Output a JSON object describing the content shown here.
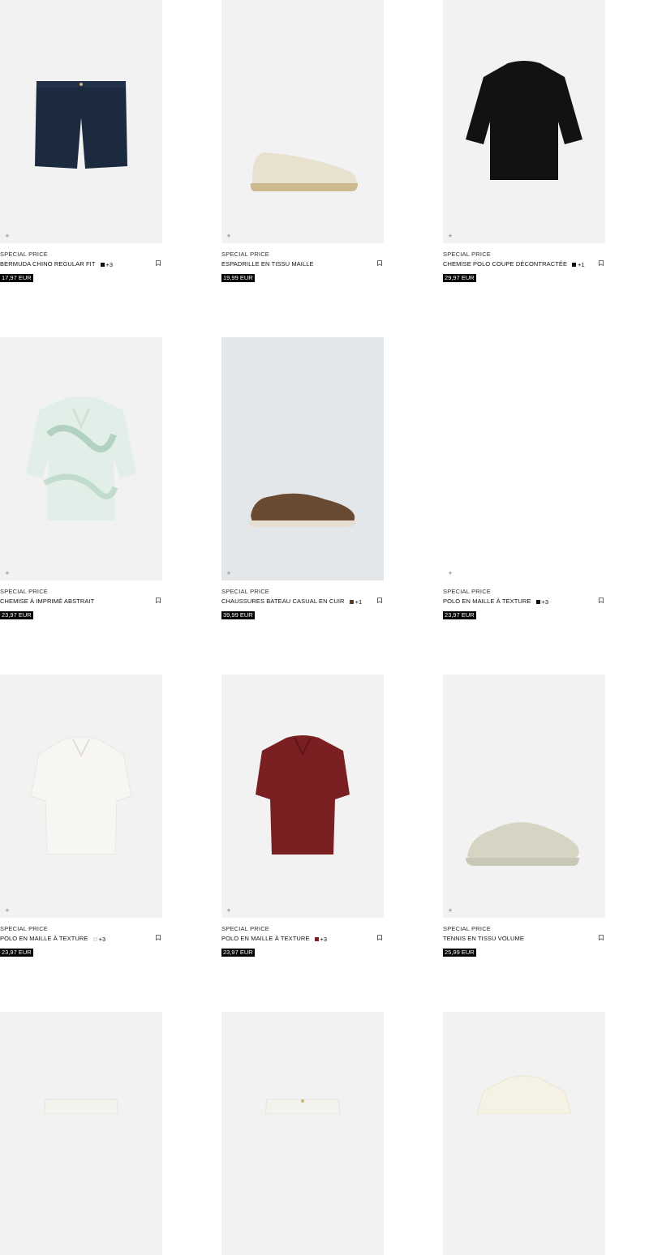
{
  "products": [
    {
      "special": "SPECIAL PRICE",
      "name": "BERMUDA CHINO REGULAR FIT",
      "swatch": "#111111",
      "more": "+3",
      "price": "17,97 EUR",
      "icon": "shorts-icon"
    },
    {
      "special": "SPECIAL PRICE",
      "name": "ESPADRILLE EN TISSU MAILLE",
      "swatch": "",
      "more": "",
      "price": "19,99 EUR",
      "icon": "espadrille-icon"
    },
    {
      "special": "SPECIAL PRICE",
      "name": "CHEMISE POLO COUPE DÉCONTRACTÉE",
      "swatch": "#111111",
      "more": "+1",
      "price": "29,97 EUR",
      "icon": "black-shirt-icon"
    },
    {
      "special": "SPECIAL PRICE",
      "name": "CHEMISE À IMPRIMÉ ABSTRAIT",
      "swatch": "",
      "more": "",
      "price": "23,97 EUR",
      "icon": "printed-shirt-icon"
    },
    {
      "special": "SPECIAL PRICE",
      "name": "CHAUSSURES BATEAU CASUAL EN CUIR",
      "swatch": "#5a3a24",
      "more": "+1",
      "price": "39,99 EUR",
      "icon": "boat-shoe-icon"
    },
    {
      "special": "SPECIAL PRICE",
      "name": "POLO EN MAILLE À TEXTURE",
      "swatch": "#111111",
      "more": "+3",
      "price": "23,97 EUR",
      "icon": "blank-image-icon"
    },
    {
      "special": "SPECIAL PRICE",
      "name": "POLO EN MAILLE À TEXTURE",
      "swatch": "#f3f1ea",
      "more": "+3",
      "price": "23,97 EUR",
      "icon": "white-polo-icon"
    },
    {
      "special": "SPECIAL PRICE",
      "name": "POLO EN MAILLE À TEXTURE",
      "swatch": "#7a1f22",
      "more": "+3",
      "price": "23,97 EUR",
      "icon": "red-polo-icon"
    },
    {
      "special": "SPECIAL PRICE",
      "name": "TENNIS EN TISSU VOLUME",
      "swatch": "",
      "more": "",
      "price": "25,99 EUR",
      "icon": "sneaker-icon"
    }
  ],
  "plus_symbol": "+"
}
